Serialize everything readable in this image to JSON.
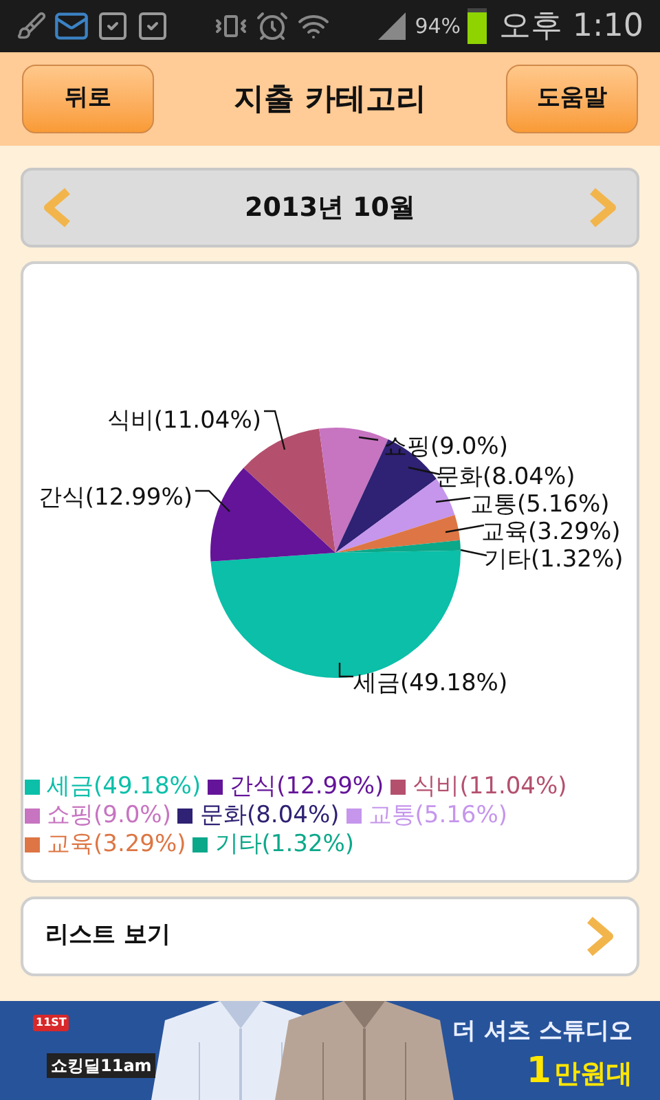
{
  "status_bar": {
    "battery": "94%",
    "time": "오후 1:10"
  },
  "header": {
    "back": "뒤로",
    "title": "지출 카테고리",
    "help": "도움말"
  },
  "month_nav": {
    "label": "2013년 10월"
  },
  "chart": {
    "chart_data": {
      "type": "pie",
      "values": [
        49.18,
        12.99,
        11.04,
        9.0,
        8.04,
        5.16,
        3.29,
        1.32
      ],
      "value_labels": [
        "세금(49.18%)",
        "간식(12.99%)",
        "식비(11.04%)",
        "쇼핑(9.0%)",
        "문화(8.04%)",
        "교통(5.16%)",
        "교육(3.29%)",
        "기타(1.32%)"
      ]
    },
    "legend": [
      {
        "label": "세금(49.18%)",
        "color": "#0bbfa9"
      },
      {
        "label": "간식(12.99%)",
        "color": "#641499"
      },
      {
        "label": "식비(11.04%)",
        "color": "#b4506e"
      },
      {
        "label": "쇼핑(9.0%)",
        "color": "#c774c1"
      },
      {
        "label": "문화(8.04%)",
        "color": "#2f2173"
      },
      {
        "label": "교통(5.16%)",
        "color": "#c596ec"
      },
      {
        "label": "교육(3.29%)",
        "color": "#dd7644"
      },
      {
        "label": "기타(1.32%)",
        "color": "#0ba88a"
      }
    ]
  },
  "list_button": {
    "label": "리스트 보기"
  },
  "ad": {
    "logo_badge": "11ST",
    "logo": "쇼킹딜11am",
    "headline": "더 셔츠 스튜디오",
    "price_number": "1",
    "price_unit": "만원대"
  }
}
